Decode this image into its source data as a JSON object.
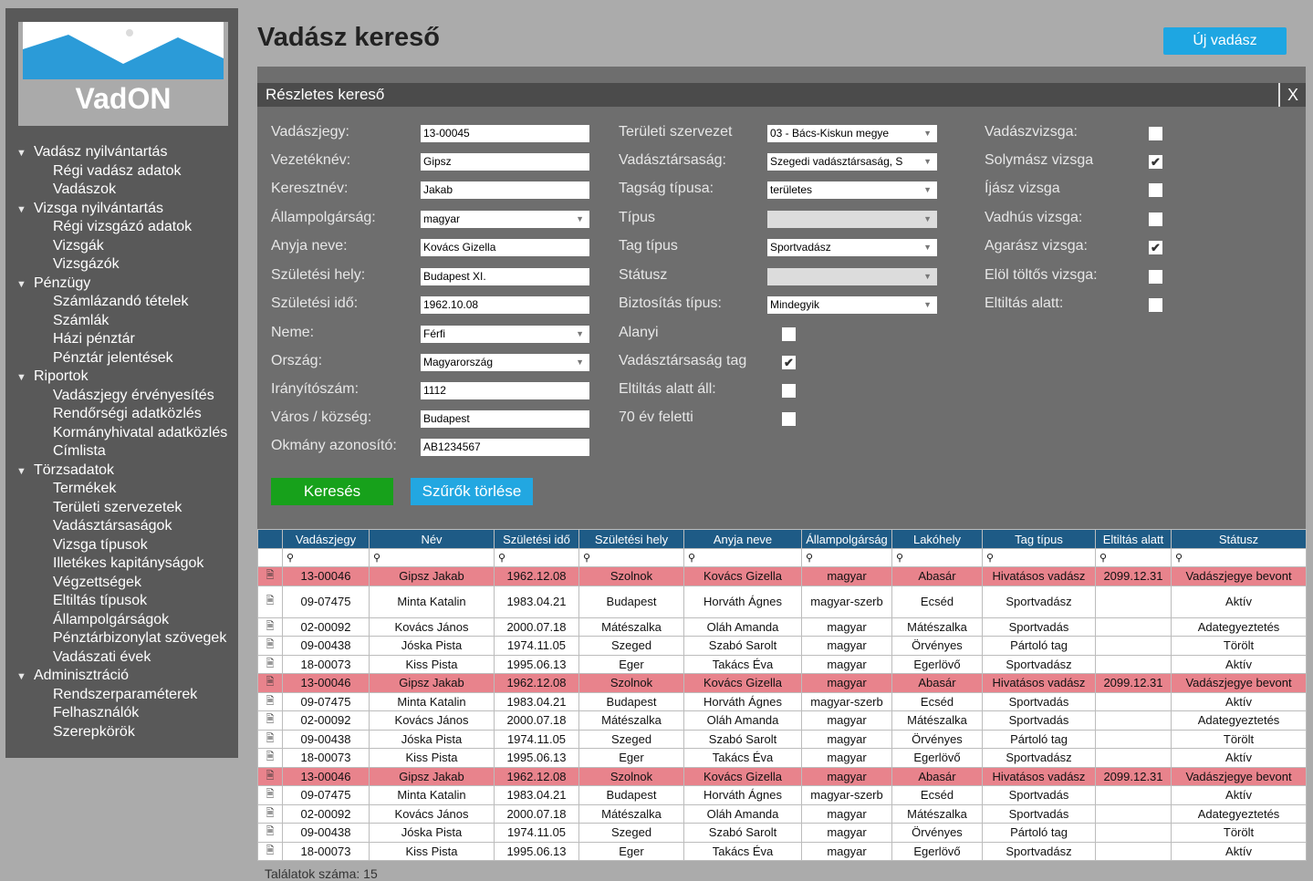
{
  "sidebar": {
    "brand": "VadON",
    "nav": [
      {
        "type": "sec",
        "label": "Vadász nyilvántartás"
      },
      {
        "type": "item",
        "label": "Régi vadász adatok"
      },
      {
        "type": "item",
        "label": "Vadászok"
      },
      {
        "type": "sec",
        "label": "Vizsga nyilvántartás"
      },
      {
        "type": "item",
        "label": "Régi vizsgázó adatok"
      },
      {
        "type": "item",
        "label": "Vizsgák"
      },
      {
        "type": "item",
        "label": "Vizsgázók"
      },
      {
        "type": "sec",
        "label": "Pénzügy"
      },
      {
        "type": "item",
        "label": "Számlázandó tételek"
      },
      {
        "type": "item",
        "label": "Számlák"
      },
      {
        "type": "item",
        "label": "Házi pénztár"
      },
      {
        "type": "item",
        "label": "Pénztár jelentések"
      },
      {
        "type": "sec",
        "label": "Riportok"
      },
      {
        "type": "item",
        "label": "Vadászjegy érvényesítés"
      },
      {
        "type": "item",
        "label": "Rendőrségi adatközlés"
      },
      {
        "type": "item",
        "label": "Kormányhivatal adatközlés"
      },
      {
        "type": "item",
        "label": "Címlista"
      },
      {
        "type": "sec",
        "label": "Törzsadatok"
      },
      {
        "type": "item",
        "label": "Termékek"
      },
      {
        "type": "item",
        "label": "Területi szervezetek"
      },
      {
        "type": "item",
        "label": "Vadásztársaságok"
      },
      {
        "type": "item",
        "label": "Vizsga típusok"
      },
      {
        "type": "item",
        "label": "Illetékes kapitányságok"
      },
      {
        "type": "item",
        "label": "Végzettségek"
      },
      {
        "type": "item",
        "label": "Eltiltás típusok"
      },
      {
        "type": "item",
        "label": "Állampolgárságok"
      },
      {
        "type": "item",
        "label": "Pénztárbizonylat szövegek"
      },
      {
        "type": "item",
        "label": "Vadászati évek"
      },
      {
        "type": "sec",
        "label": "Adminisztráció"
      },
      {
        "type": "item",
        "label": "Rendszerparaméterek"
      },
      {
        "type": "item",
        "label": "Felhasználók"
      },
      {
        "type": "item",
        "label": "Szerepkörök"
      }
    ]
  },
  "header": {
    "title": "Vadász kereső",
    "new_button": "Új vadász"
  },
  "panel": {
    "title": "Részletes kereső",
    "close": "X",
    "search_button": "Keresés",
    "clear_button": "Szűrők törlése",
    "col1": [
      {
        "label": "Vadászjegy:",
        "value": "13-00045",
        "kind": "input"
      },
      {
        "label": "Vezetéknév:",
        "value": "Gipsz",
        "kind": "input"
      },
      {
        "label": "Keresztnév:",
        "value": "Jakab",
        "kind": "input"
      },
      {
        "label": "Állampolgárság:",
        "value": "magyar",
        "kind": "select"
      },
      {
        "label": "Anyja neve:",
        "value": "Kovács Gizella",
        "kind": "input"
      },
      {
        "label": "Születési hely:",
        "value": "Budapest XI.",
        "kind": "input"
      },
      {
        "label": "Születési idő:",
        "value": "1962.10.08",
        "kind": "input"
      },
      {
        "label": "Neme:",
        "value": "Férfi",
        "kind": "select"
      },
      {
        "label": "Ország:",
        "value": "Magyarország",
        "kind": "select"
      },
      {
        "label": "Irányítószám:",
        "value": "1112",
        "kind": "input"
      },
      {
        "label": "Város / község:",
        "value": "Budapest",
        "kind": "input"
      },
      {
        "label": "Okmány azonosító:",
        "value": "AB1234567",
        "kind": "input"
      }
    ],
    "col2": [
      {
        "label": "Területi szervezet",
        "value": "03 - Bács-Kiskun megye",
        "kind": "select"
      },
      {
        "label": "Vadásztársaság:",
        "value": "Szegedi vadásztársaság, S",
        "kind": "select"
      },
      {
        "label": "Tagság típusa:",
        "value": "területes",
        "kind": "select"
      },
      {
        "label": "Típus",
        "value": "",
        "kind": "select-disabled"
      },
      {
        "label": "Tag típus",
        "value": "Sportvadász",
        "kind": "select"
      },
      {
        "label": "Státusz",
        "value": "",
        "kind": "select-disabled"
      },
      {
        "label": "Biztosítás típus:",
        "value": "Mindegyik",
        "kind": "select"
      },
      {
        "label": "Alanyi",
        "checked": false,
        "kind": "check"
      },
      {
        "label": "Vadásztársaság tag",
        "checked": true,
        "kind": "check"
      },
      {
        "label": "Eltiltás alatt áll:",
        "checked": false,
        "kind": "check"
      },
      {
        "label": "70 év feletti",
        "checked": false,
        "kind": "check"
      }
    ],
    "col3": [
      {
        "label": "Vadászvizsga:",
        "checked": false
      },
      {
        "label": "Solymász vizsga",
        "checked": true
      },
      {
        "label": "Íjász vizsga",
        "checked": false
      },
      {
        "label": "Vadhús vizsga:",
        "checked": false
      },
      {
        "label": "Agarász vizsga:",
        "checked": true
      },
      {
        "label": "Elöl töltős vizsga:",
        "checked": false
      },
      {
        "label": "Eltiltás alatt:",
        "checked": false
      }
    ]
  },
  "results": {
    "columns": [
      "",
      "Vadászjegy",
      "Név",
      "Születési idő",
      "Születési hely",
      "Anyja neve",
      "Állampolgárság",
      "Lakóhely",
      "Tag típus",
      "Eltiltás alatt",
      "Státusz"
    ],
    "filter_icon": "⚲",
    "doc_icon": "🗎",
    "rows": [
      {
        "hl": true,
        "cells": [
          "13-00046",
          "Gipsz Jakab",
          "1962.12.08",
          "Szolnok",
          "Kovács Gizella",
          "magyar",
          "Abasár",
          "Hivatásos vadász",
          "2099.12.31",
          "Vadászjegye bevont"
        ]
      },
      {
        "hl": false,
        "tall": true,
        "cells": [
          "09-07475",
          "Minta Katalin",
          "1983.04.21",
          "Budapest",
          "Horváth Ágnes",
          "magyar-szerb",
          "Ecséd",
          "Sportvadász",
          "",
          "Aktív"
        ]
      },
      {
        "hl": false,
        "cells": [
          "02-00092",
          "Kovács János",
          "2000.07.18",
          "Mátészalka",
          "Oláh Amanda",
          "magyar",
          "Mátészalka",
          "Sportvadás",
          "",
          "Adategyeztetés"
        ]
      },
      {
        "hl": false,
        "cells": [
          "09-00438",
          "Jóska Pista",
          "1974.11.05",
          "Szeged",
          "Szabó Sarolt",
          "magyar",
          "Örvényes",
          "Pártoló tag",
          "",
          "Törölt"
        ]
      },
      {
        "hl": false,
        "cells": [
          "18-00073",
          "Kiss Pista",
          "1995.06.13",
          "Eger",
          "Takács Éva",
          "magyar",
          "Egerlövő",
          "Sportvadász",
          "",
          "Aktív"
        ]
      },
      {
        "hl": true,
        "cells": [
          "13-00046",
          "Gipsz Jakab",
          "1962.12.08",
          "Szolnok",
          "Kovács Gizella",
          "magyar",
          "Abasár",
          "Hivatásos vadász",
          "2099.12.31",
          "Vadászjegye bevont"
        ]
      },
      {
        "hl": false,
        "cells": [
          "09-07475",
          "Minta Katalin",
          "1983.04.21",
          "Budapest",
          "Horváth Ágnes",
          "magyar-szerb",
          "Ecséd",
          "Sportvadás",
          "",
          "Aktív"
        ]
      },
      {
        "hl": false,
        "cells": [
          "02-00092",
          "Kovács János",
          "2000.07.18",
          "Mátészalka",
          "Oláh Amanda",
          "magyar",
          "Mátészalka",
          "Sportvadás",
          "",
          "Adategyeztetés"
        ]
      },
      {
        "hl": false,
        "cells": [
          "09-00438",
          "Jóska Pista",
          "1974.11.05",
          "Szeged",
          "Szabó Sarolt",
          "magyar",
          "Örvényes",
          "Pártoló tag",
          "",
          "Törölt"
        ]
      },
      {
        "hl": false,
        "cells": [
          "18-00073",
          "Kiss Pista",
          "1995.06.13",
          "Eger",
          "Takács Éva",
          "magyar",
          "Egerlövő",
          "Sportvadász",
          "",
          "Aktív"
        ]
      },
      {
        "hl": true,
        "cells": [
          "13-00046",
          "Gipsz Jakab",
          "1962.12.08",
          "Szolnok",
          "Kovács Gizella",
          "magyar",
          "Abasár",
          "Hivatásos vadász",
          "2099.12.31",
          "Vadászjegye bevont"
        ]
      },
      {
        "hl": false,
        "cells": [
          "09-07475",
          "Minta Katalin",
          "1983.04.21",
          "Budapest",
          "Horváth Ágnes",
          "magyar-szerb",
          "Ecséd",
          "Sportvadás",
          "",
          "Aktív"
        ]
      },
      {
        "hl": false,
        "cells": [
          "02-00092",
          "Kovács János",
          "2000.07.18",
          "Mátészalka",
          "Oláh Amanda",
          "magyar",
          "Mátészalka",
          "Sportvadás",
          "",
          "Adategyeztetés"
        ]
      },
      {
        "hl": false,
        "cells": [
          "09-00438",
          "Jóska Pista",
          "1974.11.05",
          "Szeged",
          "Szabó Sarolt",
          "magyar",
          "Örvényes",
          "Pártoló tag",
          "",
          "Törölt"
        ]
      },
      {
        "hl": false,
        "cells": [
          "18-00073",
          "Kiss Pista",
          "1995.06.13",
          "Eger",
          "Takács Éva",
          "magyar",
          "Egerlövő",
          "Sportvadász",
          "",
          "Aktív"
        ]
      }
    ]
  },
  "footer": {
    "count_text": "Találatok száma: 15"
  },
  "colors": {
    "sidebar": "#595959",
    "panel": "#6e6e6e",
    "table_header": "#1e5b86",
    "highlight_row": "#e8838c",
    "search_btn": "#17a11b",
    "clear_btn": "#22a7e1"
  }
}
